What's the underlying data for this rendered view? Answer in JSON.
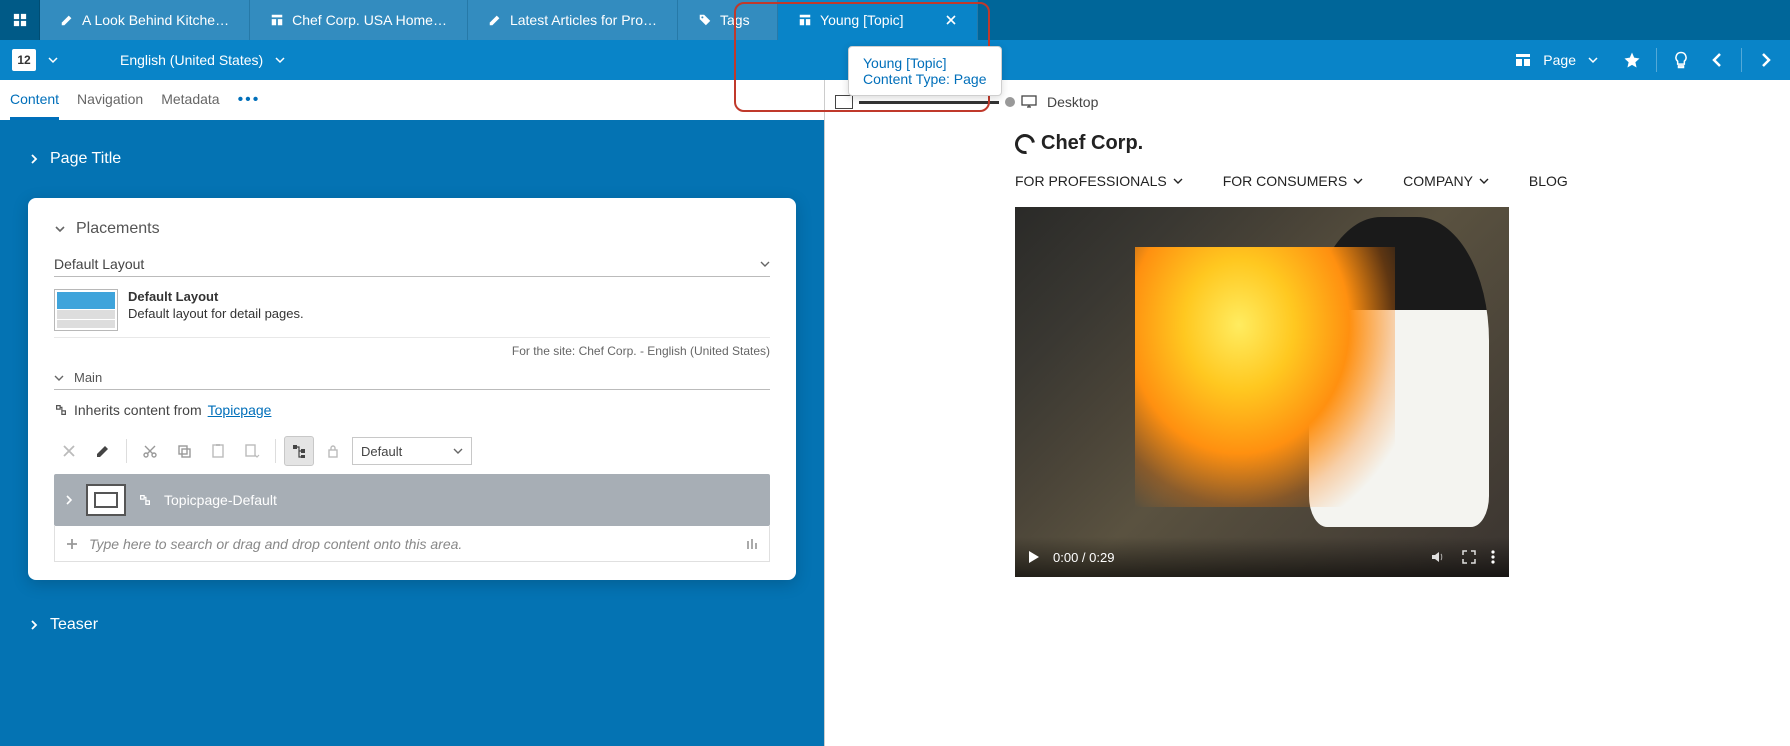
{
  "tabs": {
    "t0": "A Look Behind Kitche…",
    "t1": "Chef Corp. USA Home…",
    "t2": "Latest Articles for Pro…",
    "t3": "Tags",
    "t4": "Young [Topic]"
  },
  "toolbar": {
    "version": "12",
    "locale": "English (United States)",
    "view": "Page"
  },
  "tooltip": {
    "line1": "Young [Topic]",
    "line2": "Content Type: Page"
  },
  "crumb": {
    "device": "Desktop"
  },
  "subtabs": {
    "content": "Content",
    "navigation": "Navigation",
    "metadata": "Metadata"
  },
  "sections": {
    "pagetitle": "Page Title",
    "placements": "Placements",
    "teaser": "Teaser"
  },
  "layout": {
    "selector": "Default Layout",
    "title": "Default Layout",
    "desc": "Default layout for detail pages.",
    "sitenote": "For the site: Chef Corp. - English (United States)",
    "main": "Main",
    "inherits_pre": "Inherits content from ",
    "inherits_link": "Topicpage",
    "variant_sel": "Default",
    "item_name": "Topicpage-Default",
    "drop_hint": "Type here to search or drag and drop content onto this area."
  },
  "preview": {
    "brand": "Chef Corp.",
    "nav": {
      "n0": "FOR PROFESSIONALS",
      "n1": "FOR CONSUMERS",
      "n2": "COMPANY",
      "n3": "BLOG"
    },
    "video_time": "0:00 / 0:29"
  }
}
